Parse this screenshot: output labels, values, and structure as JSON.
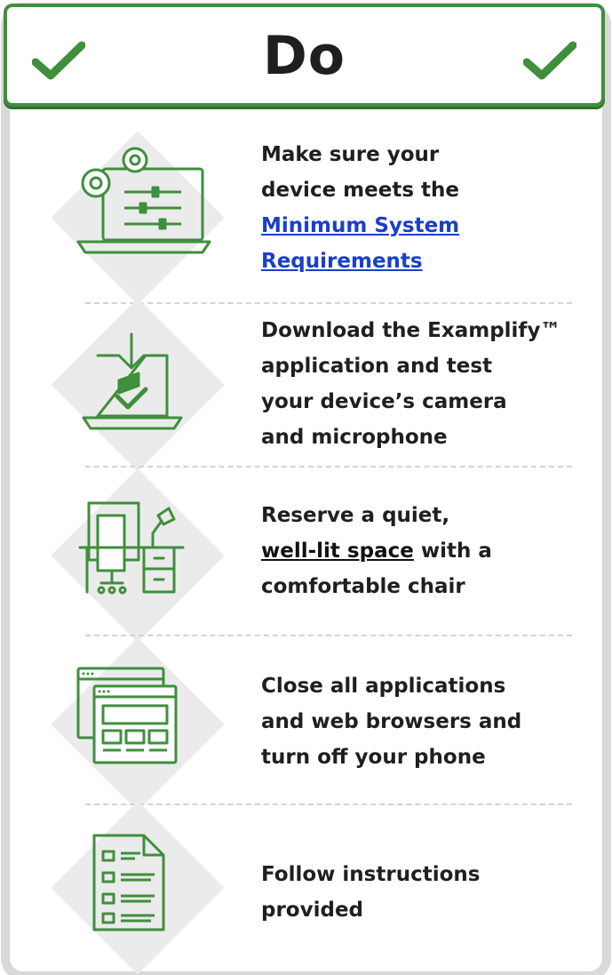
{
  "header": {
    "title": "Do",
    "left_icon": "check-icon",
    "right_icon": "check-icon",
    "accent_color": "#3f8f3c"
  },
  "items": [
    {
      "icon": "laptop-settings-icon",
      "lines": [
        "Make sure your",
        "device meets the"
      ],
      "link_lines": [
        "Minimum System",
        "Requirements"
      ]
    },
    {
      "icon": "laptop-download-icon",
      "lines": [
        "Download the Examplify™",
        "application and test",
        "your device’s camera",
        "and microphone"
      ]
    },
    {
      "icon": "desk-workspace-icon",
      "line1": "Reserve a quiet,",
      "link": "well-lit space",
      "after_link": " with a",
      "line3": "comfortable chair"
    },
    {
      "icon": "browser-windows-icon",
      "lines": [
        "Close all applications",
        "and web browsers and",
        "turn off your phone"
      ]
    },
    {
      "icon": "checklist-document-icon",
      "lines": [
        "Follow instructions",
        "provided"
      ]
    }
  ]
}
